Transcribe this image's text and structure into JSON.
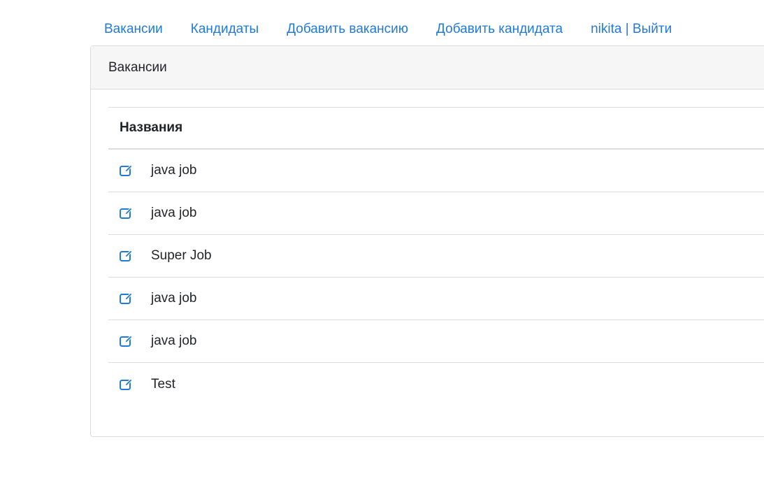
{
  "nav": {
    "items": [
      {
        "label": "Вакансии"
      },
      {
        "label": "Кандидаты"
      },
      {
        "label": "Добавить вакансию"
      },
      {
        "label": "Добавить кандидата"
      },
      {
        "label": "nikita | Выйти"
      }
    ]
  },
  "card": {
    "header": "Вакансии",
    "table": {
      "column_header": "Названия",
      "rows": [
        {
          "name": "java job",
          "icon": "edit-icon"
        },
        {
          "name": "java job",
          "icon": "edit-icon"
        },
        {
          "name": "Super Job",
          "icon": "edit-icon"
        },
        {
          "name": "java job",
          "icon": "edit-icon"
        },
        {
          "name": "java job",
          "icon": "edit-icon"
        },
        {
          "name": "Test",
          "icon": "edit-icon"
        }
      ]
    }
  },
  "colors": {
    "link": "#1f7ae0",
    "header_bg": "#f6f6f6",
    "border": "#dcdcdc"
  }
}
